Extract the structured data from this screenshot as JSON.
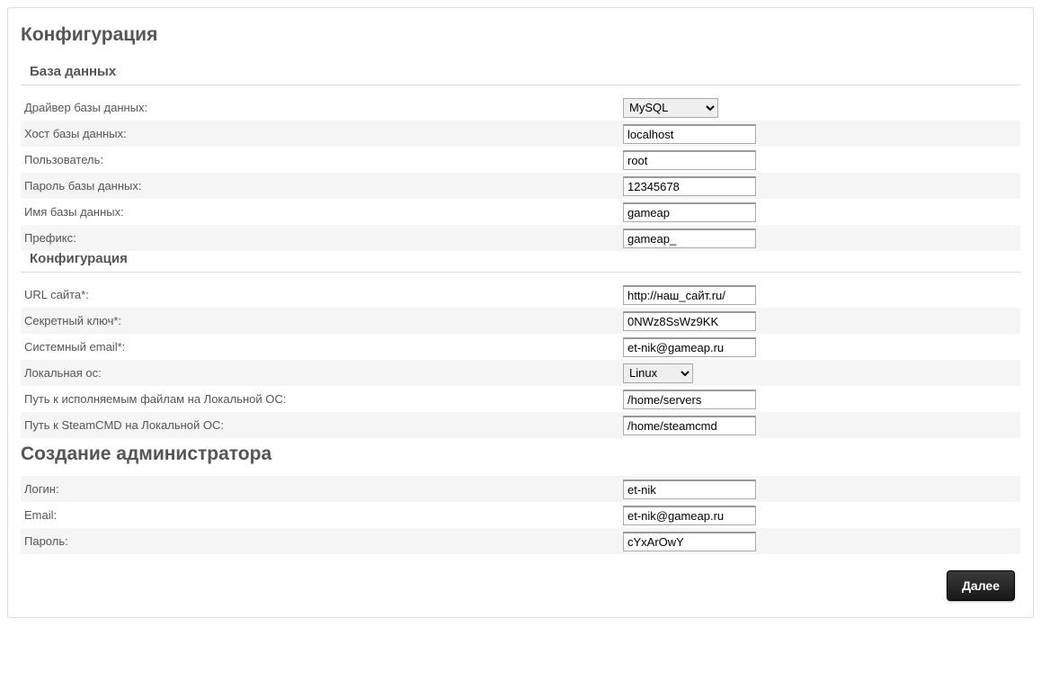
{
  "page": {
    "title": "Конфигурация",
    "admin_title": "Создание администратора"
  },
  "sections": {
    "database": {
      "legend": "База данных",
      "driver": {
        "label": "Драйвер базы данных:",
        "value": "MySQL"
      },
      "host": {
        "label": "Хост базы данных:",
        "value": "localhost"
      },
      "user": {
        "label": "Пользователь:",
        "value": "root"
      },
      "password": {
        "label": "Пароль базы данных:",
        "value": "12345678"
      },
      "name": {
        "label": "Имя базы данных:",
        "value": "gameap"
      },
      "prefix": {
        "label": "Префикс:",
        "value": "gameap_"
      }
    },
    "config": {
      "legend": "Конфигурация",
      "url": {
        "label": "URL сайта*:",
        "value": "http://наш_сайт.ru/"
      },
      "secret": {
        "label": "Секретный ключ*:",
        "value": "0NWz8SsWz9KK"
      },
      "email": {
        "label": "Системный email*:",
        "value": "et-nik@gameap.ru"
      },
      "os": {
        "label": "Локальная ос:",
        "value": "Linux"
      },
      "exec_path": {
        "label": "Путь к исполняемым файлам на Локальной ОС:",
        "value": "/home/servers"
      },
      "steamcmd_path": {
        "label": "Путь к SteamCMD на Локальной ОС:",
        "value": "/home/steamcmd"
      }
    },
    "admin": {
      "login": {
        "label": "Логин:",
        "value": "et-nik"
      },
      "email": {
        "label": "Email:",
        "value": "et-nik@gameap.ru"
      },
      "password": {
        "label": "Пароль:",
        "value": "cYxArOwY"
      }
    }
  },
  "actions": {
    "next": "Далее"
  }
}
